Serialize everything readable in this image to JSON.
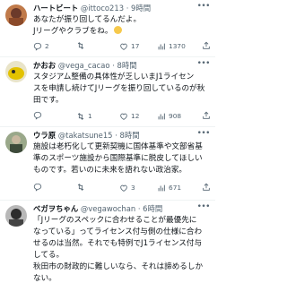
{
  "tweets": [
    {
      "name": "ハートビート",
      "handle": "@ittoco213",
      "time": "· 9時間",
      "text": "あなたが振り回してるんだよ。\nJリーグやクラブをね。",
      "emoji": "smiling-face",
      "replies": "2",
      "retweets": "",
      "likes": "17",
      "views": "1370",
      "avatar_colors": [
        "#6b3a2a",
        "#c07a4a"
      ]
    },
    {
      "name": "かおお",
      "handle": "@vega_cacao",
      "time": "· 8時間",
      "text": "スタジアム整備の具体性が乏しいまJ1ライセン\nスを申請し続けてJリーグを振り回しているのが秋\n田です。",
      "replies": "",
      "retweets": "1",
      "likes": "12",
      "views": "908",
      "avatar_colors": [
        "#e3c200",
        "#2a2a2a"
      ]
    },
    {
      "name": "ウラ原",
      "handle": "@takatsune15",
      "time": "· 8時間",
      "text": "施設は老朽化して更新契機に国体基準や文部省基\n準のスポーツ施設から国際基準に脱皮してほしい\nものです。若いのに未来を語れない政治家。",
      "replies": "",
      "retweets": "",
      "likes": "3",
      "views": "671",
      "avatar_colors": [
        "#7a8a6a",
        "#3d4a3a"
      ]
    },
    {
      "name": "ベガヲちゃん",
      "handle": "@vegawochan",
      "time": "· 6時間",
      "text": "「Jリーグのスペックに合わせることが最優先に\nなっている」ってライセンス付与側の仕様に合わ\nせるのは当然。それでも特例でJ1ライセンス付与\nしてる。\n秋田市の財政的に難しいなら、それは諦めるしか\nない。",
      "replies": "",
      "retweets": "",
      "likes": "",
      "views": "",
      "avatar_colors": [
        "#2c2c2c",
        "#b8b8b8"
      ]
    }
  ],
  "icons": {
    "reply": "reply-icon",
    "retweet": "retweet-icon",
    "like": "heart-icon",
    "views": "views-chart-icon",
    "share": "share-icon",
    "more": "more-icon"
  },
  "colors": {
    "text": "#0f1419",
    "muted": "#536471",
    "divider": "#eff3f4"
  }
}
